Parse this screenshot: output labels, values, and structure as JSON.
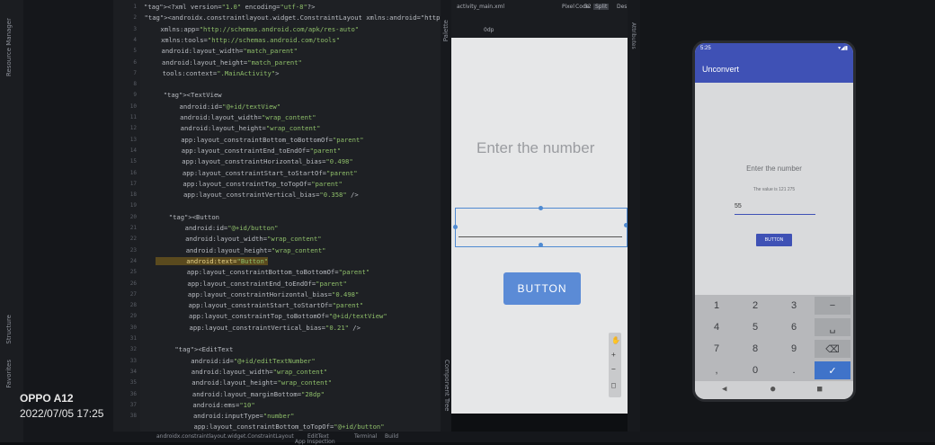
{
  "watermark": {
    "device": "OPPO A12",
    "datetime": "2022/07/05 17:25"
  },
  "left_strip": {
    "resource_manager": "Resource Manager",
    "structure": "Structure",
    "favorites": "Favorites"
  },
  "gutter_numbers": [
    "1",
    "2",
    "3",
    "4",
    "5",
    "6",
    "7",
    "8",
    "9",
    "10",
    "11",
    "12",
    "13",
    "14",
    "15",
    "16",
    "17",
    "18",
    "19",
    "20",
    "21",
    "22",
    "23",
    "24",
    "25",
    "26",
    "27",
    "28",
    "29",
    "30",
    "31",
    "32",
    "33",
    "34",
    "35",
    "36",
    "37",
    "38"
  ],
  "code_lines": [
    [
      "<?xml version=\"1.0\" encoding=\"utf-8\"?>"
    ],
    [
      "<androidx.constraintlayout.widget.ConstraintLayout xmlns:android=\"http:"
    ],
    [
      "    xmlns:app=\"http://schemas.android.com/apk/res-auto\""
    ],
    [
      "    xmlns:tools=\"http://schemas.android.com/tools\""
    ],
    [
      "    android:layout_width=\"match_parent\""
    ],
    [
      "    android:layout_height=\"match_parent\""
    ],
    [
      "    tools:context=\".MainActivity\">"
    ],
    [
      ""
    ],
    [
      "    <TextView"
    ],
    [
      "        android:id=\"@+id/textView\""
    ],
    [
      "        android:layout_width=\"wrap_content\""
    ],
    [
      "        android:layout_height=\"wrap_content\""
    ],
    [
      "        app:layout_constraintBottom_toBottomOf=\"parent\""
    ],
    [
      "        app:layout_constraintEnd_toEndOf=\"parent\""
    ],
    [
      "        app:layout_constraintHorizontal_bias=\"0.498\""
    ],
    [
      "        app:layout_constraintStart_toStartOf=\"parent\""
    ],
    [
      "        app:layout_constraintTop_toTopOf=\"parent\""
    ],
    [
      "        app:layout_constraintVertical_bias=\"0.358\" />"
    ],
    [
      ""
    ],
    [
      "    <Button"
    ],
    [
      "        android:id=\"@+id/button\""
    ],
    [
      "        android:layout_width=\"wrap_content\""
    ],
    [
      "        android:layout_height=\"wrap_content\""
    ],
    [
      "        android:text=\"Button\""
    ],
    [
      "        app:layout_constraintBottom_toBottomOf=\"parent\""
    ],
    [
      "        app:layout_constraintEnd_toEndOf=\"parent\""
    ],
    [
      "        app:layout_constraintHorizontal_bias=\"0.498\""
    ],
    [
      "        app:layout_constraintStart_toStartOf=\"parent\""
    ],
    [
      "        app:layout_constraintTop_toBottomOf=\"@+id/textView\""
    ],
    [
      "        app:layout_constraintVertical_bias=\"0.21\" />"
    ],
    [
      ""
    ],
    [
      "    <EditText"
    ],
    [
      "        android:id=\"@+id/editTextNumber\""
    ],
    [
      "        android:layout_width=\"wrap_content\""
    ],
    [
      "        android:layout_height=\"wrap_content\""
    ],
    [
      "        android:layout_marginBottom=\"28dp\""
    ],
    [
      "        android:ems=\"10\""
    ],
    [
      "        android:inputType=\"number\""
    ],
    [
      "        app:layout_constraintBottom_toTopOf=\"@+id/button\""
    ]
  ],
  "design_toolbar": {
    "file": "activity_main.xml",
    "device": "Pixel",
    "api": "32",
    "mode_code": "Code",
    "mode_split": "Split",
    "mode_design": "Design",
    "dp": "0dp"
  },
  "preview": {
    "hint": "Enter the number",
    "button": "BUTTON"
  },
  "side_labels": {
    "palette": "Palette",
    "component_tree": "Component Tree",
    "attributes": "Attributes"
  },
  "phone": {
    "time": "5:25",
    "title": "Unconvert",
    "hint": "Enter the number",
    "value_line": "The value is 121 275",
    "input_value": "55",
    "button": "BUTTON",
    "keys": [
      [
        "1",
        "2",
        "3",
        "−"
      ],
      [
        "4",
        "5",
        "6",
        "␣"
      ],
      [
        "7",
        "8",
        "9",
        "⌫"
      ],
      [
        ",",
        "0",
        ".",
        "✓"
      ]
    ]
  },
  "bottom_bar": {
    "breadcrumb": "androidx.constraintlayout.widget.ConstraintLayout",
    "edittext": "EditText",
    "terminal": "Terminal",
    "build": "Build",
    "app_inspection": "App Inspection"
  },
  "colors": {
    "accent": "#3f51b5",
    "preview_button": "#5b8bd6",
    "code_bg": "#1e2024"
  }
}
